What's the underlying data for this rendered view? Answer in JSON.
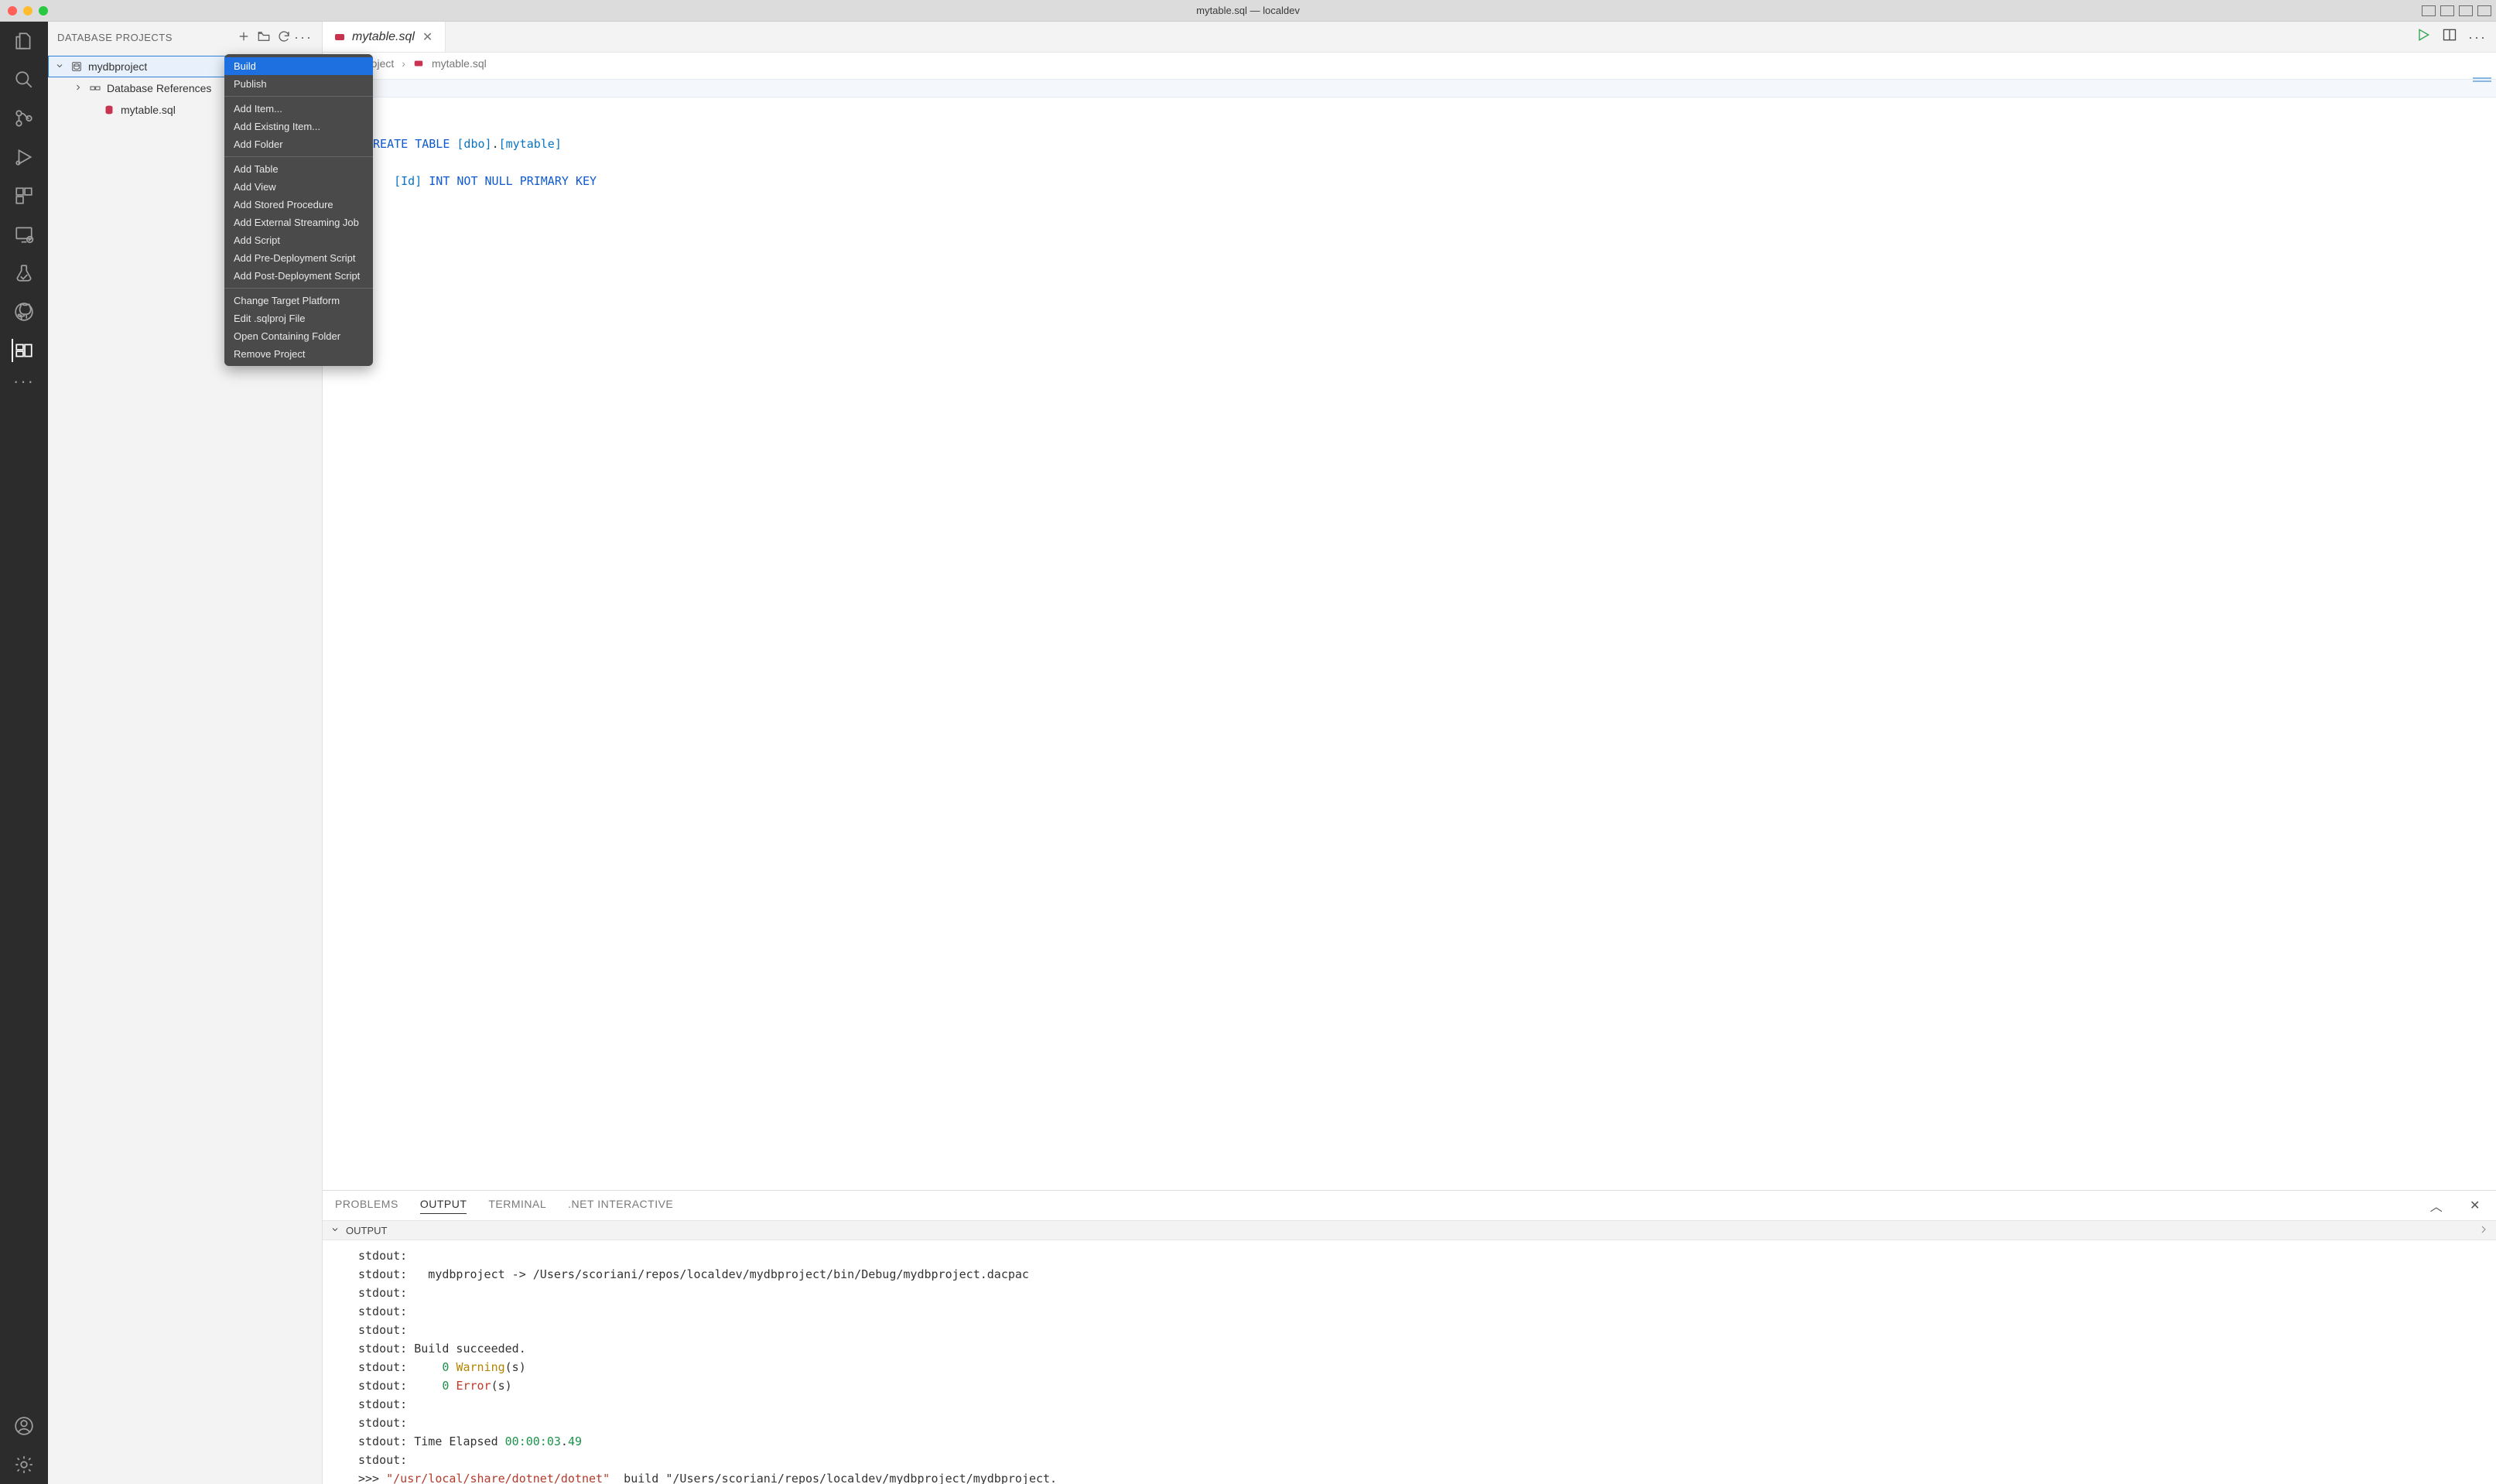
{
  "window": {
    "title": "mytable.sql — localdev"
  },
  "sidebar": {
    "title": "DATABASE PROJECTS",
    "tree": {
      "project": "mydbproject",
      "folder": "Database References",
      "file": "mytable.sql"
    }
  },
  "context_menu": {
    "items": [
      "Build",
      "Publish",
      "Add Item...",
      "Add Existing Item...",
      "Add Folder",
      "Add Table",
      "Add View",
      "Add Stored Procedure",
      "Add External Streaming Job",
      "Add Script",
      "Add Pre-Deployment Script",
      "Add Post-Deployment Script",
      "Change Target Platform",
      "Edit .sqlproj File",
      "Open Containing Folder",
      "Remove Project"
    ],
    "selected": "Build",
    "separators_after": [
      1,
      4,
      11
    ]
  },
  "editor": {
    "tab": {
      "label": "mytable.sql"
    },
    "breadcrumb": {
      "project": "mydbproject",
      "file": "mytable.sql"
    },
    "lines": [
      "CREATE TABLE [dbo].[mytable]",
      "(",
      "    [Id] INT NOT NULL PRIMARY KEY",
      ")",
      ""
    ]
  },
  "panel": {
    "tabs": [
      "PROBLEMS",
      "OUTPUT",
      "TERMINAL",
      ".NET INTERACTIVE"
    ],
    "active": "OUTPUT",
    "section": "OUTPUT",
    "output_lines": [
      "stdout:",
      "stdout:   mydbproject -> /Users/scoriani/repos/localdev/mydbproject/bin/Debug/mydbproject.dacpac",
      "stdout:",
      "stdout:",
      "stdout:",
      "stdout: Build succeeded.",
      "stdout:     0 Warning(s)",
      "stdout:     0 Error(s)",
      "stdout:",
      "stdout:",
      "stdout: Time Elapsed 00:00:03.49",
      "stdout:",
      ">>> \"/usr/local/share/dotnet/dotnet\"  build \"/Users/scoriani/repos/localdev/mydbproject/mydbproject."
    ]
  }
}
